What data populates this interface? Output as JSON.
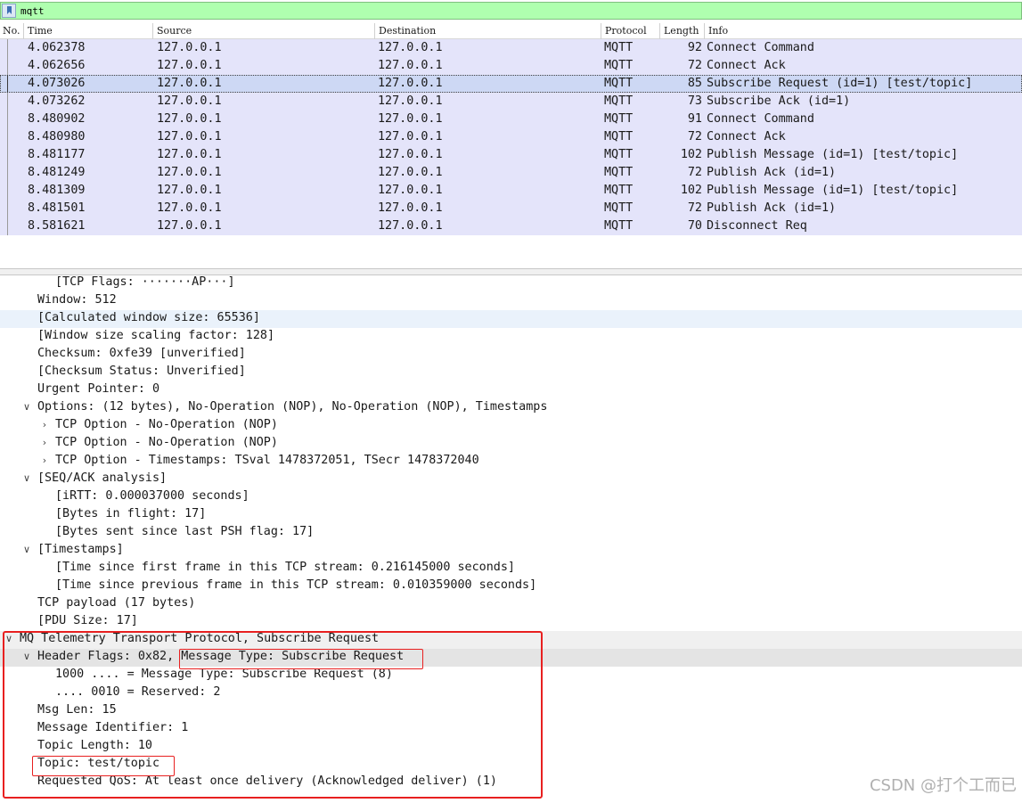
{
  "filter": {
    "value": "mqtt"
  },
  "columns": [
    "No.",
    "Time",
    "Source",
    "Destination",
    "Protocol",
    "Length",
    "Info"
  ],
  "packets": [
    {
      "time": "4.062378",
      "source": "127.0.0.1",
      "destination": "127.0.0.1",
      "protocol": "MQTT",
      "length": "92",
      "info": "Connect Command"
    },
    {
      "time": "4.062656",
      "source": "127.0.0.1",
      "destination": "127.0.0.1",
      "protocol": "MQTT",
      "length": "72",
      "info": "Connect Ack"
    },
    {
      "time": "4.073026",
      "source": "127.0.0.1",
      "destination": "127.0.0.1",
      "protocol": "MQTT",
      "length": "85",
      "info": "Subscribe Request (id=1) [test/topic]"
    },
    {
      "time": "4.073262",
      "source": "127.0.0.1",
      "destination": "127.0.0.1",
      "protocol": "MQTT",
      "length": "73",
      "info": "Subscribe Ack (id=1)"
    },
    {
      "time": "8.480902",
      "source": "127.0.0.1",
      "destination": "127.0.0.1",
      "protocol": "MQTT",
      "length": "91",
      "info": "Connect Command"
    },
    {
      "time": "8.480980",
      "source": "127.0.0.1",
      "destination": "127.0.0.1",
      "protocol": "MQTT",
      "length": "72",
      "info": "Connect Ack"
    },
    {
      "time": "8.481177",
      "source": "127.0.0.1",
      "destination": "127.0.0.1",
      "protocol": "MQTT",
      "length": "102",
      "info": "Publish Message (id=1) [test/topic]"
    },
    {
      "time": "8.481249",
      "source": "127.0.0.1",
      "destination": "127.0.0.1",
      "protocol": "MQTT",
      "length": "72",
      "info": "Publish Ack (id=1)"
    },
    {
      "time": "8.481309",
      "source": "127.0.0.1",
      "destination": "127.0.0.1",
      "protocol": "MQTT",
      "length": "102",
      "info": "Publish Message (id=1) [test/topic]"
    },
    {
      "time": "8.481501",
      "source": "127.0.0.1",
      "destination": "127.0.0.1",
      "protocol": "MQTT",
      "length": "72",
      "info": "Publish Ack (id=1)"
    },
    {
      "time": "8.581621",
      "source": "127.0.0.1",
      "destination": "127.0.0.1",
      "protocol": "MQTT",
      "length": "70",
      "info": "Disconnect Req"
    }
  ],
  "selected_packet_index": 2,
  "details": [
    {
      "text": "[TCP Flags: ·······AP···]"
    },
    {
      "text": "Window: 512"
    },
    {
      "text": "[Calculated window size: 65536]"
    },
    {
      "text": "[Window size scaling factor: 128]"
    },
    {
      "text": "Checksum: 0xfe39 [unverified]"
    },
    {
      "text": "[Checksum Status: Unverified]"
    },
    {
      "text": "Urgent Pointer: 0"
    },
    {
      "text": "Options: (12 bytes), No-Operation (NOP), No-Operation (NOP), Timestamps"
    },
    {
      "text": "TCP Option - No-Operation (NOP)"
    },
    {
      "text": "TCP Option - No-Operation (NOP)"
    },
    {
      "text": "TCP Option - Timestamps: TSval 1478372051, TSecr 1478372040"
    },
    {
      "text": "[SEQ/ACK analysis]"
    },
    {
      "text": "[iRTT: 0.000037000 seconds]"
    },
    {
      "text": "[Bytes in flight: 17]"
    },
    {
      "text": "[Bytes sent since last PSH flag: 17]"
    },
    {
      "text": "[Timestamps]"
    },
    {
      "text": "[Time since first frame in this TCP stream: 0.216145000 seconds]"
    },
    {
      "text": "[Time since previous frame in this TCP stream: 0.010359000 seconds]"
    },
    {
      "text": "TCP payload (17 bytes)"
    },
    {
      "text": "[PDU Size: 17]"
    },
    {
      "text": "MQ Telemetry Transport Protocol, Subscribe Request"
    },
    {
      "text": "Header Flags: 0x82, Message Type: Subscribe Request"
    },
    {
      "text": "1000 .... = Message Type: Subscribe Request (8)"
    },
    {
      "text": ".... 0010 = Reserved: 2"
    },
    {
      "text": "Msg Len: 15"
    },
    {
      "text": "Message Identifier: 1"
    },
    {
      "text": "Topic Length: 10"
    },
    {
      "text": "Topic: test/topic"
    },
    {
      "text": "Requested QoS: At least once delivery (Acknowledged deliver) (1)"
    }
  ],
  "watermark": "CSDN @打个工而已",
  "colors": {
    "filter_bg": "#afffaf",
    "row_bg": "#e4e4fa",
    "selected_row_bg": "#cdd8f4",
    "annotation": "#e82020"
  }
}
